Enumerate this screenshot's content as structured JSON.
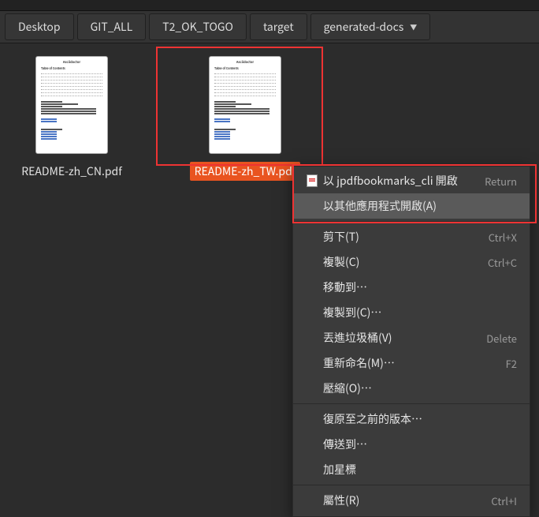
{
  "breadcrumb": {
    "items": [
      {
        "label": "Desktop"
      },
      {
        "label": "GIT_ALL"
      },
      {
        "label": "T2_OK_TOGO"
      },
      {
        "label": "target"
      },
      {
        "label": "generated-docs"
      }
    ]
  },
  "files": [
    {
      "name": "README-zh_CN.pdf",
      "selected": false
    },
    {
      "name": "README-zh_TW.pdf",
      "selected": true
    }
  ],
  "pdf_thumb": {
    "title": "Asciidoctor",
    "toc": "Table of Contents"
  },
  "context_menu": {
    "items": [
      {
        "label": "以 jpdfbookmarks_cli 開啟",
        "accel": "Return",
        "icon": "pdf",
        "hover": false
      },
      {
        "label": "以其他應用程式開啟(A)",
        "accel": "",
        "icon": "",
        "hover": true
      },
      {
        "sep": true
      },
      {
        "label": "剪下(T)",
        "accel": "Ctrl+X"
      },
      {
        "label": "複製(C)",
        "accel": "Ctrl+C"
      },
      {
        "label": "移動到…",
        "accel": ""
      },
      {
        "label": "複製到(C)…",
        "accel": ""
      },
      {
        "label": "丟進垃圾桶(V)",
        "accel": "Delete"
      },
      {
        "label": "重新命名(M)…",
        "accel": "F2"
      },
      {
        "label": "壓縮(O)…",
        "accel": ""
      },
      {
        "sep": true
      },
      {
        "label": "復原至之前的版本…",
        "accel": ""
      },
      {
        "label": "傳送到…",
        "accel": ""
      },
      {
        "label": "加星標",
        "accel": ""
      },
      {
        "sep": true
      },
      {
        "label": "屬性(R)",
        "accel": "Ctrl+I"
      }
    ]
  }
}
